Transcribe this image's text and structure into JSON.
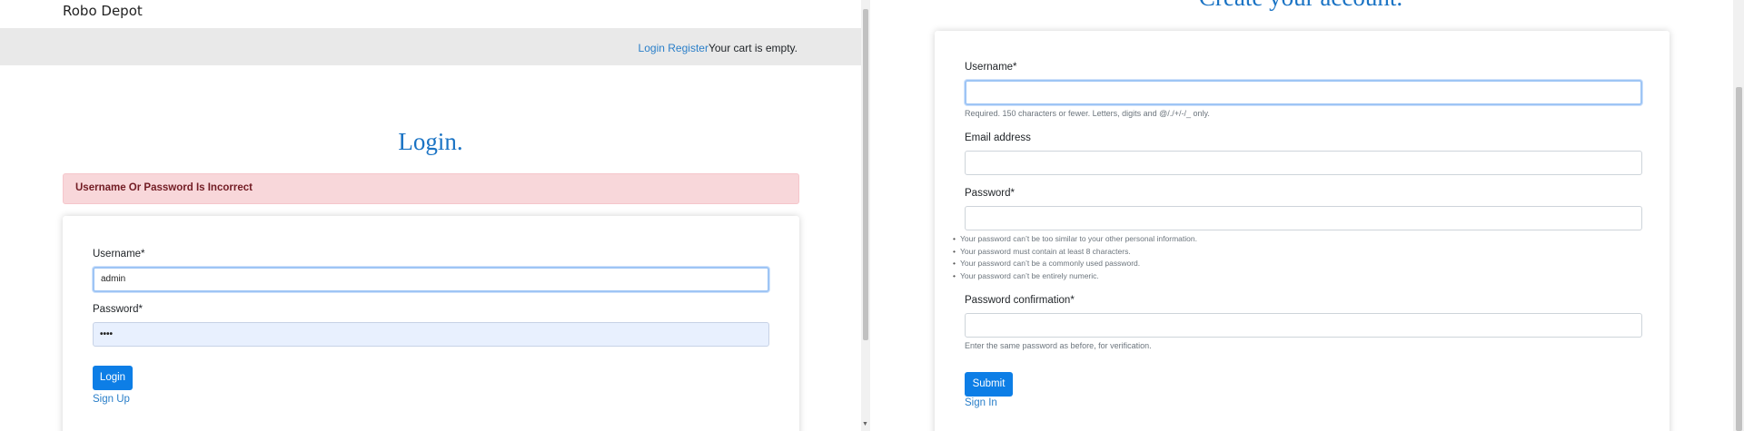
{
  "left": {
    "brand": "Robo Depot",
    "nav": {
      "login": "Login",
      "register": "Register",
      "cart": "Your cart is empty."
    },
    "title": "Login.",
    "alert": "Username Or Password Is Incorrect",
    "form": {
      "username_label": "Username*",
      "username_value": "admin",
      "password_label": "Password*",
      "password_value": "••••",
      "login_button": "Login",
      "signup_link": "Sign Up"
    }
  },
  "right": {
    "title": "Create your account.",
    "form": {
      "username_label": "Username*",
      "username_value": "",
      "username_help": "Required. 150 characters or fewer. Letters, digits and @/./+/-/_ only.",
      "email_label": "Email address",
      "email_value": "",
      "password_label": "Password*",
      "password_value": "",
      "password_rules": [
        "Your password can’t be too similar to your other personal information.",
        "Your password must contain at least 8 characters.",
        "Your password can’t be a commonly used password.",
        "Your password can’t be entirely numeric."
      ],
      "confirm_label": "Password confirmation*",
      "confirm_value": "",
      "confirm_help": "Enter the same password as before, for verification.",
      "submit_button": "Submit",
      "signin_link": "Sign In"
    }
  },
  "colors": {
    "accent": "#0d7ee6",
    "link": "#2a7fc9",
    "title": "#1a73c4",
    "alert_bg": "#f8d7da",
    "alert_text": "#721c24"
  }
}
